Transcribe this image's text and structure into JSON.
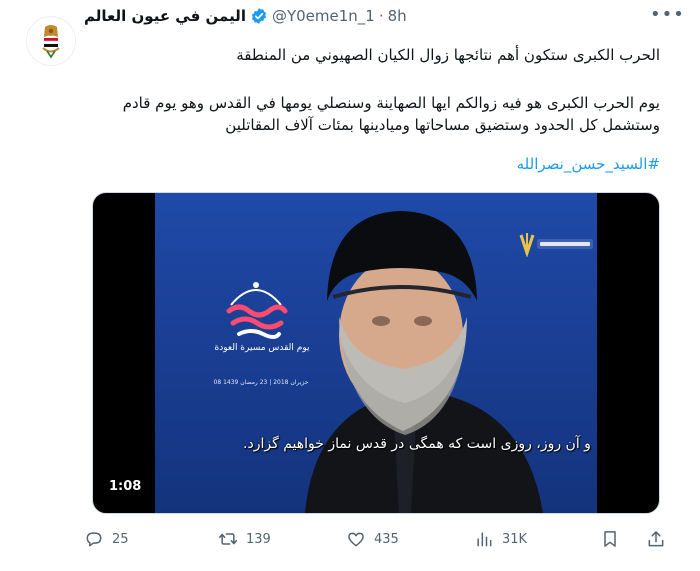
{
  "tweet": {
    "display_name": "اليمن في عيون العالم",
    "handle": "@Y0eme1n_1",
    "separator": "·",
    "time": "8h",
    "text_line1": "الحرب الكبرى ستكون أهم نتائجها زوال الكيان الصهيوني من المنطقة",
    "text_line2": "يوم الحرب الكبرى هو فيه زوالكم ايها الصهاينة وسنصلي يومها في القدس وهو يوم قادم وستشمل كل الحدود وستضيق مساحاتها وميادينها بمئات آلاف المقاتلين",
    "hashtag": "#السيد_حسن_نصرالله"
  },
  "video": {
    "duration": "1:08",
    "subtitle": "و آن روز، روزی است که همگی در قدس نماز خواهیم گزارد.",
    "overlay_slogan": "يوم القدس مسيرة العودة",
    "overlay_dates": "08 حزيران 2018 | 23 رمضان 1439"
  },
  "actions": {
    "replies": "25",
    "reposts": "139",
    "likes": "435",
    "views": "31K"
  },
  "colors": {
    "accent": "#1d9bf0",
    "secondary_text": "#536471",
    "video_background": "#1f4aa8"
  },
  "icons": {
    "verified": "verified-badge-icon",
    "more": "more-options-icon",
    "reply": "reply-icon",
    "repost": "repost-icon",
    "like": "heart-icon",
    "views": "views-chart-icon",
    "bookmark": "bookmark-icon",
    "share": "share-icon"
  }
}
